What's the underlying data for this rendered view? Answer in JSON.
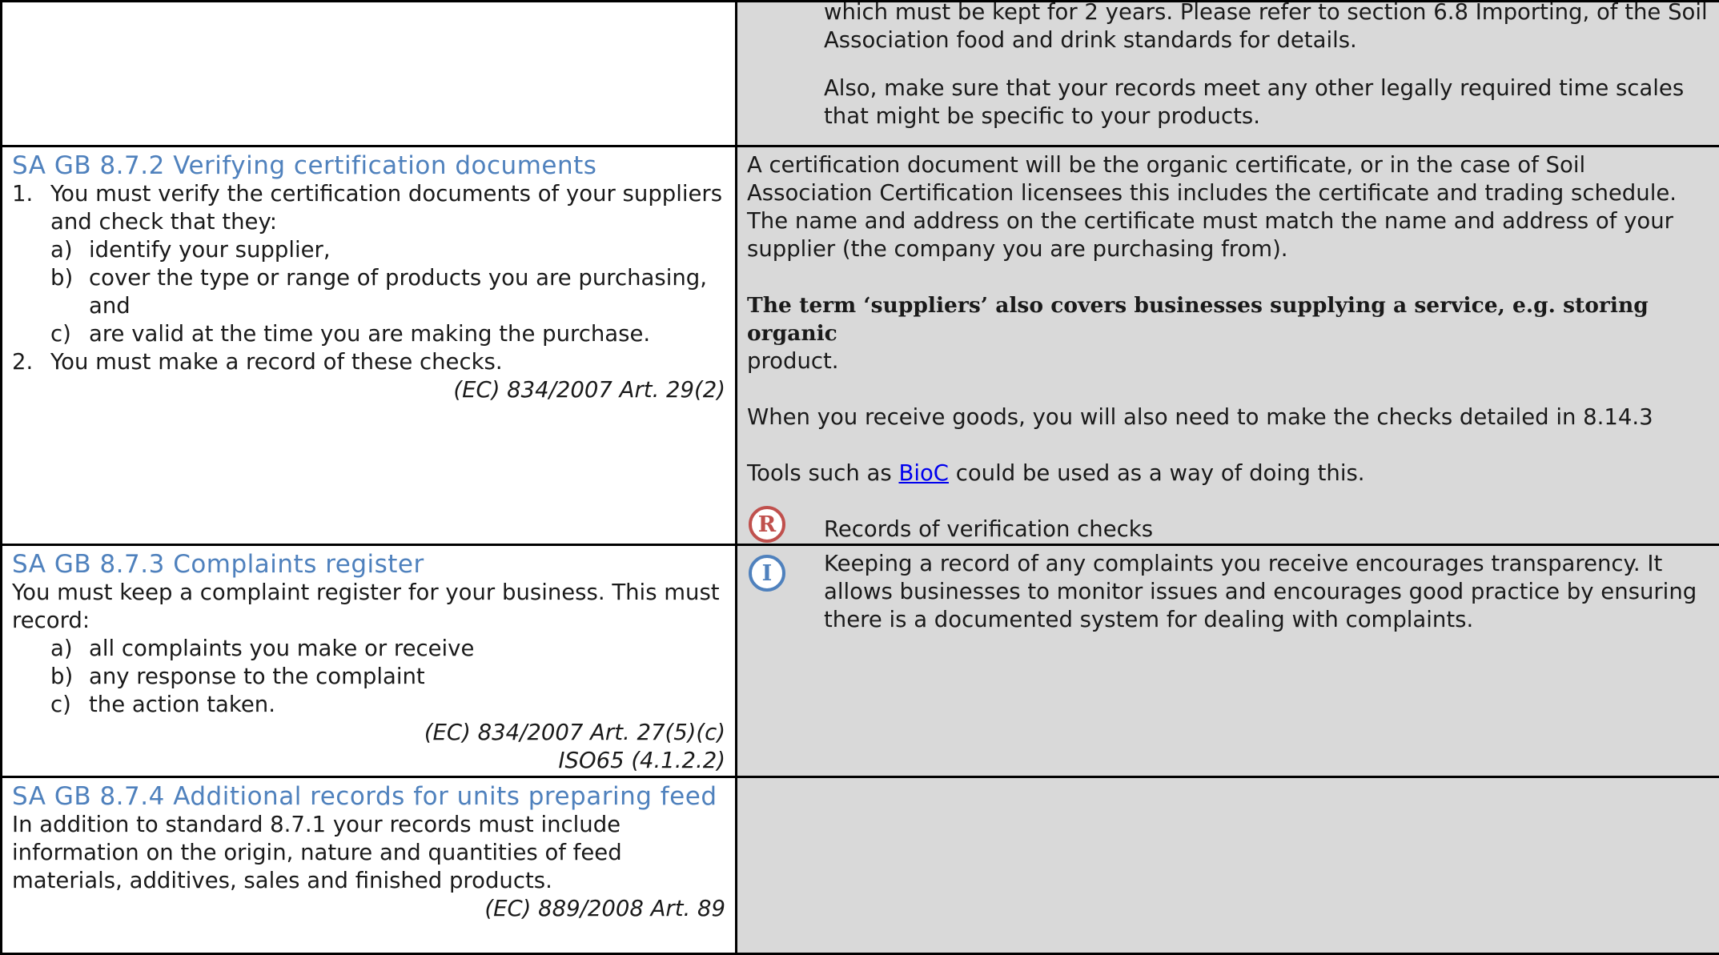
{
  "rows": [
    {
      "right": {
        "p1": "which must be kept for 2 years. Please refer to section 6.8 Importing, of the Soil Association food and drink standards for details.",
        "p2": "Also, make sure that your records meet any other legally required time scales that might be specific to your products."
      }
    },
    {
      "heading": "SA GB 8.7.2 Verifying certification documents",
      "items": [
        {
          "num": "1.",
          "text": "You must verify the certification documents of your suppliers and check that they:",
          "sub": [
            {
              "label": "a)",
              "text": "identify your supplier,"
            },
            {
              "label": "b)",
              "text": "cover the type or range of products you are purchasing, and"
            },
            {
              "label": "c)",
              "text": "are valid at the time you are making the purchase."
            }
          ]
        },
        {
          "num": "2.",
          "text": "You must make a record of these checks."
        }
      ],
      "reference": "(EC) 834/2007 Art. 29(2)",
      "right": {
        "p1": "A certification document will be the organic certificate, or in the case of Soil Association Certification licensees this includes the certificate and trading schedule. The name and address on the certificate must match the name and address of your supplier (the company you are purchasing from).",
        "p2_bold": "The term ‘suppliers’ also covers businesses supplying a service, e.g. storing organic",
        "p2_rest": "product.",
        "p3": "When you receive goods, you will also need to make the checks detailed in 8.14.3",
        "p4_before": "Tools such as ",
        "p4_link": "BioC",
        "p4_after": " could be used as a way of doing this.",
        "record_icon_letter": "R",
        "record_text": "Records of verification checks"
      }
    },
    {
      "heading": "SA GB 8.7.3 Complaints register",
      "intro": "You must keep a complaint register for your business. This must record:",
      "sub": [
        {
          "label": "a)",
          "text": "all complaints you make or receive"
        },
        {
          "label": "b)",
          "text": "any response to the complaint"
        },
        {
          "label": "c)",
          "text": "the action taken."
        }
      ],
      "references": [
        "(EC) 834/2007 Art. 27(5)(c)",
        "ISO65 (4.1.2.2)"
      ],
      "right": {
        "info_icon_letter": "I",
        "info_text": "Keeping a record of any complaints you receive encourages transparency. It allows businesses to monitor issues and encourages good practice by ensuring there is a documented system for dealing with complaints."
      }
    },
    {
      "heading": "SA GB 8.7.4 Additional records for units preparing feed",
      "text": "In addition to standard 8.7.1 your records must include information on the origin, nature and quantities of feed materials, additives, sales and finished products.",
      "reference": "(EC) 889/2008 Art. 89"
    }
  ],
  "colors": {
    "heading": "#4f81bd",
    "right_bg": "#d9d9d9",
    "record_icon": "#c0504d",
    "info_icon": "#4f81bd",
    "link": "#0000ee"
  },
  "icons": {
    "record": "record-icon",
    "info": "info-icon"
  }
}
